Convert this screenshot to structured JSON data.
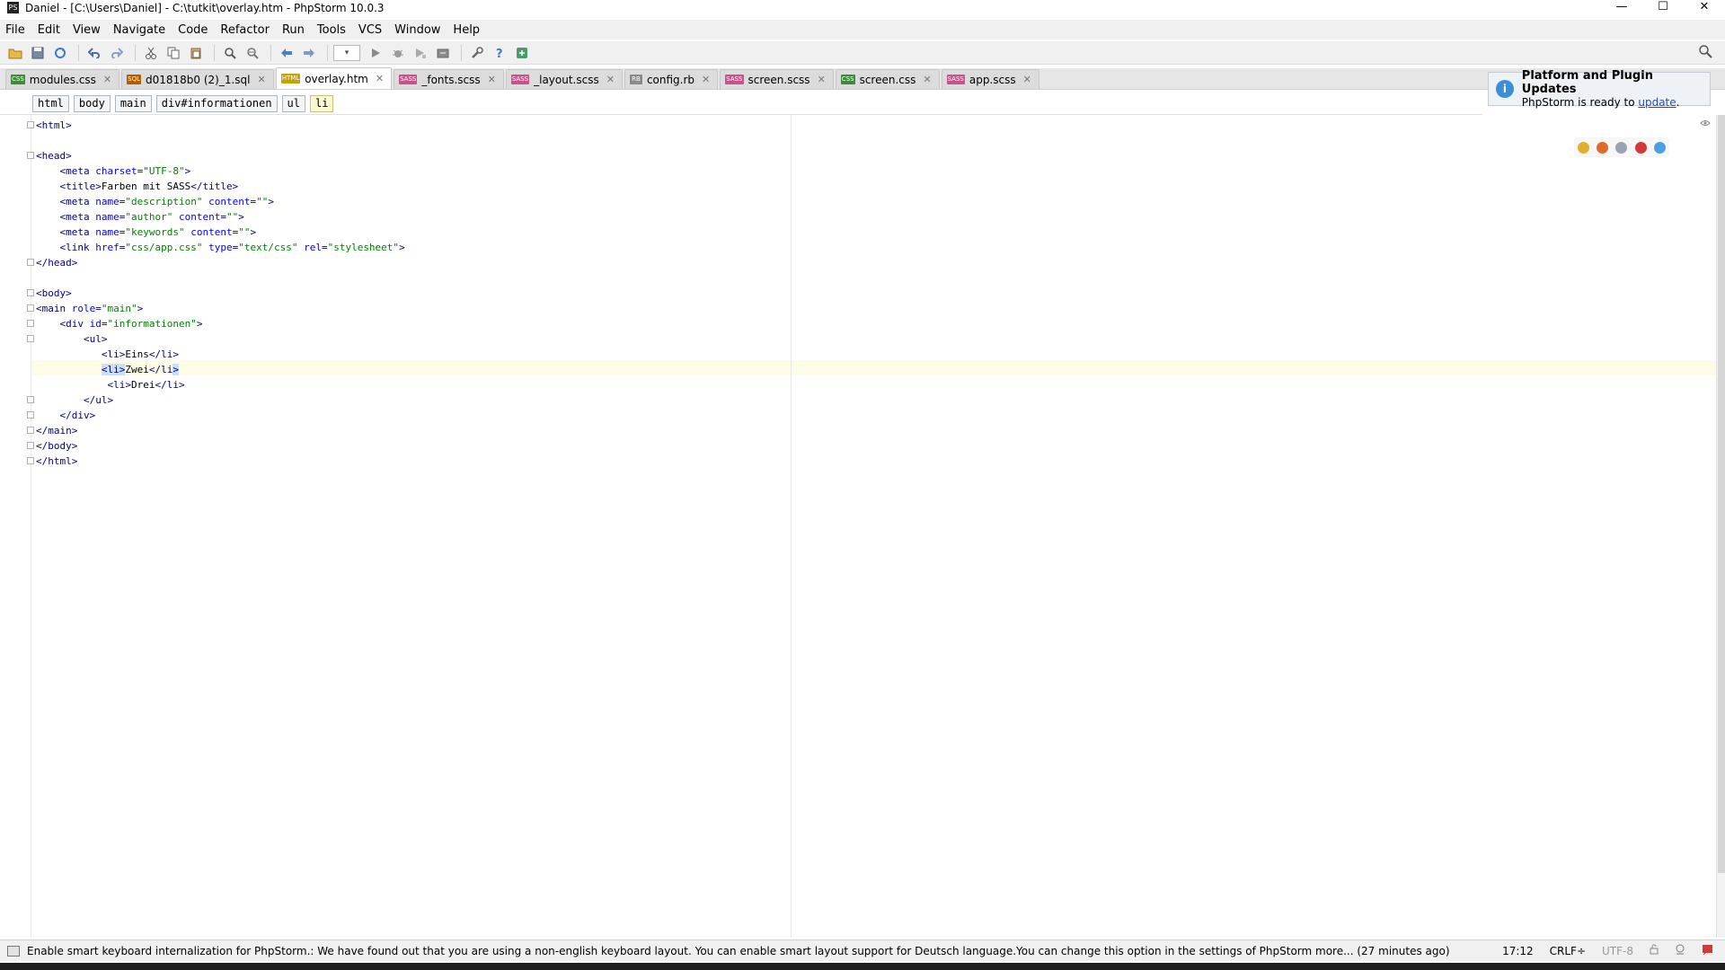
{
  "window": {
    "title": "Daniel - [C:\\Users\\Daniel] - C:\\tutkit\\overlay.htm - PhpStorm 10.0.3",
    "minimize": "—",
    "maximize": "☐",
    "close": "✕"
  },
  "menu": [
    "File",
    "Edit",
    "View",
    "Navigate",
    "Code",
    "Refactor",
    "Run",
    "Tools",
    "VCS",
    "Window",
    "Help"
  ],
  "tabs": [
    {
      "label": "modules.css",
      "type": "CSS",
      "color": "#3d8a3d"
    },
    {
      "label": "d01818b0 (2)_1.sql",
      "type": "SQL",
      "color": "#b35c00"
    },
    {
      "label": "overlay.htm",
      "type": "HTML",
      "color": "#c8a200",
      "active": true
    },
    {
      "label": "_fonts.scss",
      "type": "SASS",
      "color": "#c6538c"
    },
    {
      "label": "_layout.scss",
      "type": "SASS",
      "color": "#c6538c"
    },
    {
      "label": "config.rb",
      "type": "RB",
      "color": "#8a8a8a"
    },
    {
      "label": "screen.scss",
      "type": "SASS",
      "color": "#c6538c"
    },
    {
      "label": "screen.css",
      "type": "CSS",
      "color": "#3d8a3d"
    },
    {
      "label": "app.scss",
      "type": "SASS",
      "color": "#c6538c"
    }
  ],
  "notification": {
    "title": "Platform and Plugin Updates",
    "body": "PhpStorm is ready to ",
    "link": "update",
    "suffix": "."
  },
  "breadcrumb": [
    "html",
    "body",
    "main",
    "div#informationen",
    "ul",
    "li"
  ],
  "code_lines": [
    [
      [
        "tg",
        "<html>"
      ]
    ],
    [],
    [
      [
        "tg",
        "<head>"
      ]
    ],
    [
      [
        "tx",
        "    "
      ],
      [
        "tg",
        "<meta "
      ],
      [
        "an",
        "charset"
      ],
      [
        "tg",
        "="
      ],
      [
        "av",
        "\"UTF-8\""
      ],
      [
        "tg",
        ">"
      ]
    ],
    [
      [
        "tx",
        "    "
      ],
      [
        "tg",
        "<title>"
      ],
      [
        "tx",
        "Farben mit SASS"
      ],
      [
        "tg",
        "</title>"
      ]
    ],
    [
      [
        "tx",
        "    "
      ],
      [
        "tg",
        "<meta "
      ],
      [
        "an",
        "name"
      ],
      [
        "tg",
        "="
      ],
      [
        "av",
        "\"description\""
      ],
      [
        "tg",
        " "
      ],
      [
        "an",
        "content"
      ],
      [
        "tg",
        "="
      ],
      [
        "av",
        "\"\""
      ],
      [
        "tg",
        ">"
      ]
    ],
    [
      [
        "tx",
        "    "
      ],
      [
        "tg",
        "<meta "
      ],
      [
        "an",
        "name"
      ],
      [
        "tg",
        "="
      ],
      [
        "av",
        "\"author\""
      ],
      [
        "tg",
        " "
      ],
      [
        "an",
        "content"
      ],
      [
        "tg",
        "="
      ],
      [
        "av",
        "\"\""
      ],
      [
        "tg",
        ">"
      ]
    ],
    [
      [
        "tx",
        "    "
      ],
      [
        "tg",
        "<meta "
      ],
      [
        "an",
        "name"
      ],
      [
        "tg",
        "="
      ],
      [
        "av",
        "\"keywords\""
      ],
      [
        "tg",
        " "
      ],
      [
        "an",
        "content"
      ],
      [
        "tg",
        "="
      ],
      [
        "av",
        "\"\""
      ],
      [
        "tg",
        ">"
      ]
    ],
    [
      [
        "tx",
        "    "
      ],
      [
        "tg",
        "<link "
      ],
      [
        "an",
        "href"
      ],
      [
        "tg",
        "="
      ],
      [
        "av",
        "\"css/app.css\""
      ],
      [
        "tg",
        " "
      ],
      [
        "an",
        "type"
      ],
      [
        "tg",
        "="
      ],
      [
        "av",
        "\"text/css\""
      ],
      [
        "tg",
        " "
      ],
      [
        "an",
        "rel"
      ],
      [
        "tg",
        "="
      ],
      [
        "av",
        "\"stylesheet\""
      ],
      [
        "tg",
        ">"
      ]
    ],
    [
      [
        "tg",
        "</head>"
      ]
    ],
    [],
    [
      [
        "tg",
        "<body>"
      ]
    ],
    [
      [
        "tg",
        "<main "
      ],
      [
        "an",
        "role"
      ],
      [
        "tg",
        "="
      ],
      [
        "av",
        "\"main\""
      ],
      [
        "tg",
        ">"
      ]
    ],
    [
      [
        "tx",
        "    "
      ],
      [
        "tg",
        "<div "
      ],
      [
        "an",
        "id"
      ],
      [
        "tg",
        "="
      ],
      [
        "av",
        "\"informationen\""
      ],
      [
        "tg",
        ">"
      ]
    ],
    [
      [
        "tx",
        "        "
      ],
      [
        "tg",
        "<ul>"
      ]
    ],
    [
      [
        "tx",
        "           "
      ],
      [
        "tg",
        "<li>"
      ],
      [
        "tx",
        "Eins"
      ],
      [
        "tg",
        "</li>"
      ]
    ],
    [
      [
        "tx",
        "           "
      ],
      [
        "hl",
        "<li>"
      ],
      [
        "tx",
        "Zwei"
      ],
      [
        "tg",
        "</li"
      ],
      [
        "hl",
        ">"
      ]
    ],
    [
      [
        "tx",
        "            "
      ],
      [
        "tg",
        "<li>"
      ],
      [
        "tx",
        "Drei"
      ],
      [
        "tg",
        "</li>"
      ]
    ],
    [
      [
        "tx",
        "        "
      ],
      [
        "tg",
        "</ul>"
      ]
    ],
    [
      [
        "tx",
        "    "
      ],
      [
        "tg",
        "</div>"
      ]
    ],
    [
      [
        "tg",
        "</main>"
      ]
    ],
    [
      [
        "tg",
        "</body>"
      ]
    ],
    [
      [
        "tg",
        "</html>"
      ]
    ]
  ],
  "status": {
    "message": "Enable smart keyboard internalization for PhpStorm.: We have found out that you are using a non-english keyboard layout. You can enable smart layout support for Deutsch language.You can change this option in the settings of PhpStorm more... (27 minutes ago)",
    "position": "17:12",
    "line_separator": "CRLF÷",
    "encoding": "UTF-8"
  },
  "colors": {
    "tag": "#000080",
    "attr_name": "#0000ff",
    "attr_value": "#008000",
    "caret_line": "#fffce6"
  }
}
